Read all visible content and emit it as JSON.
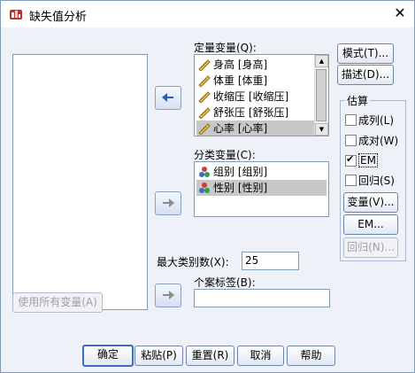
{
  "window": {
    "title": "缺失值分析"
  },
  "labels": {
    "quant_vars": "定量变量(Q):",
    "cat_vars": "分类变量(C):",
    "max_cat": "最大类别数(X):",
    "case_labels": "个案标签(B):",
    "estimate": "估算"
  },
  "quant_vars": [
    {
      "label": "身高 [身高]",
      "icon": "ruler-icon"
    },
    {
      "label": "体重 [体重]",
      "icon": "ruler-icon"
    },
    {
      "label": "收缩压 [收缩压]",
      "icon": "ruler-icon"
    },
    {
      "label": "舒张压 [舒张压]",
      "icon": "ruler-icon"
    },
    {
      "label": "心率 [心率]",
      "icon": "ruler-icon"
    }
  ],
  "cat_vars": [
    {
      "label": "组别 [组别]",
      "icon": "nominal-icon"
    },
    {
      "label": "性别 [性别]",
      "icon": "nominal-icon"
    }
  ],
  "max_cat_value": "25",
  "case_label_value": "",
  "right_buttons": {
    "patterns": "模式(T)...",
    "descriptives": "描述(D)..."
  },
  "estimate": {
    "listwise": {
      "label": "成列(L)",
      "checked": false
    },
    "pairwise": {
      "label": "成对(W)",
      "checked": false
    },
    "em": {
      "label": "EM",
      "checked": true
    },
    "regression": {
      "label": "回归(S)",
      "checked": false
    },
    "variables_btn": "变量(V)...",
    "em_btn": "EM...",
    "regression_btn": "回归(N)..."
  },
  "use_all_vars": "使用所有变量(A)",
  "footer": {
    "ok": "确定",
    "paste": "粘贴(P)",
    "reset": "重置(R)",
    "cancel": "取消",
    "help": "帮助"
  },
  "colors": {
    "arrow_active": "#2a5cb0",
    "arrow_inactive": "#8c8c8c",
    "selection": "#c8c8c8"
  }
}
